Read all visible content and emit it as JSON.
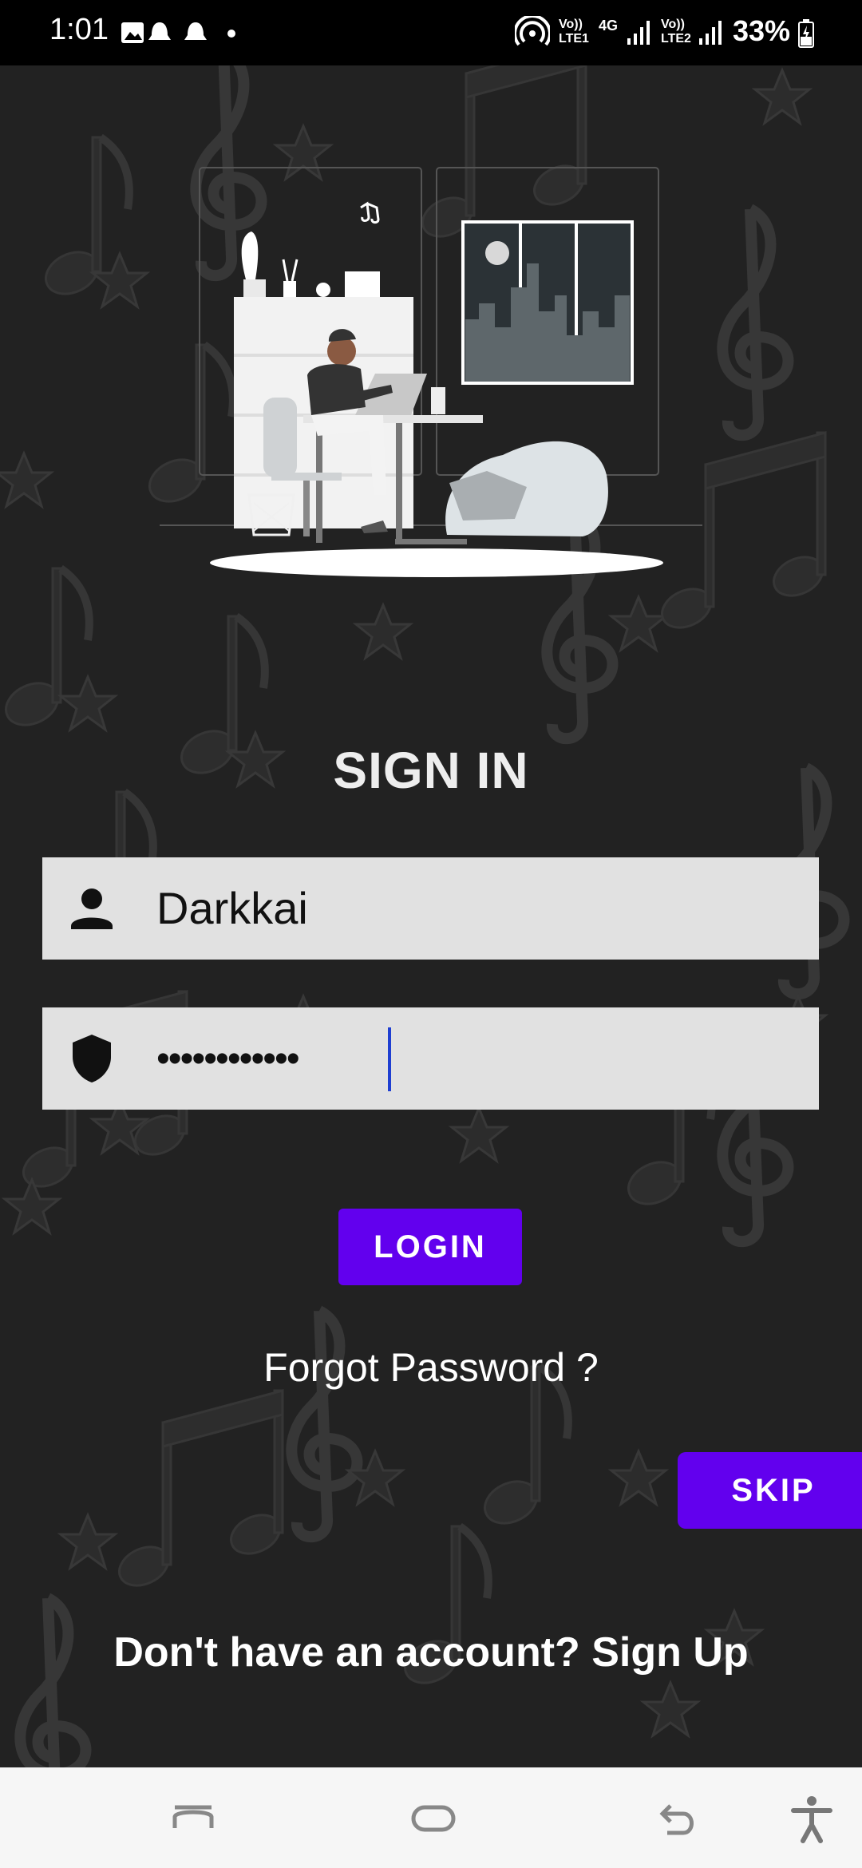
{
  "status_bar": {
    "time": "1:01",
    "network_1": "Vo)) LTE1",
    "network_type": "4G",
    "network_2": "Vo)) LTE2",
    "battery": "33%"
  },
  "screen": {
    "title": "SIGN IN",
    "username": {
      "value": "Darkkai",
      "icon": "person-icon"
    },
    "password": {
      "masked_value": "••••••••••••",
      "icon": "shield-icon"
    },
    "login_label": "LOGIN",
    "forgot_label": "Forgot Password ?",
    "skip_label": "SKIP",
    "signup_text": "Don't have an account? Sign Up"
  },
  "colors": {
    "accent": "#6200ee",
    "background": "#222222",
    "field_bg": "#e1e1e1"
  },
  "nav_bar": {
    "icons": [
      "recents-icon",
      "home-icon",
      "back-icon",
      "accessibility-icon"
    ]
  }
}
